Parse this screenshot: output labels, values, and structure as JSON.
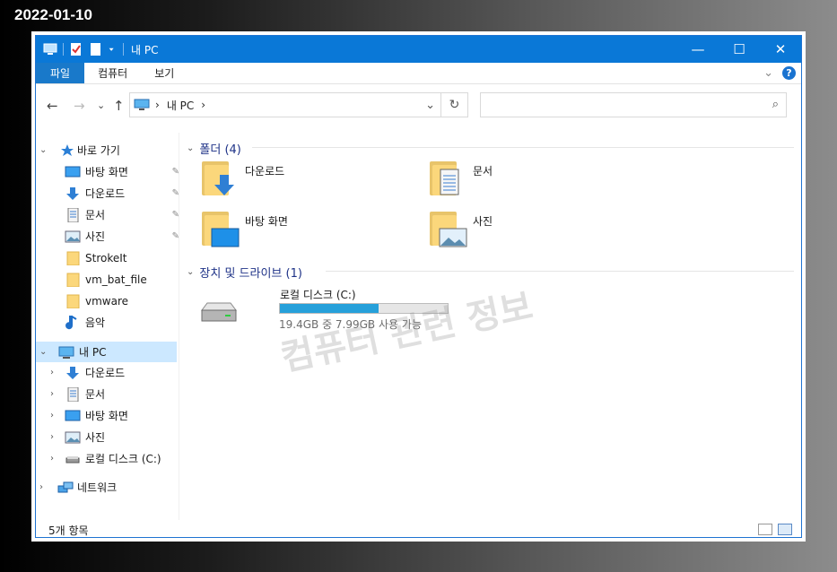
{
  "date_stamp": "2022-01-10",
  "window": {
    "title": "내 PC",
    "controls": {
      "minimize": "—",
      "maximize": "☐",
      "close": "✕"
    }
  },
  "ribbon": {
    "tabs": [
      "파일",
      "컴퓨터",
      "보기"
    ],
    "expand_glyph": "⌄",
    "help_glyph": "?"
  },
  "address": {
    "back": "←",
    "forward": "→",
    "recent": "⌄",
    "up": "↑",
    "crumbs": [
      "›",
      "내 PC",
      "›"
    ],
    "dropdown": "⌄",
    "refresh": "↻",
    "search_placeholder": "",
    "search_glyph": "⌕"
  },
  "nav": {
    "quick_access": "바로 가기",
    "quick_items": [
      {
        "label": "바탕 화면",
        "icon": "desktop-icon",
        "pinned": true
      },
      {
        "label": "다운로드",
        "icon": "download-icon",
        "pinned": true
      },
      {
        "label": "문서",
        "icon": "document-icon",
        "pinned": true
      },
      {
        "label": "사진",
        "icon": "pictures-icon",
        "pinned": true
      },
      {
        "label": "StrokeIt",
        "icon": "folder-icon",
        "pinned": false
      },
      {
        "label": "vm_bat_file",
        "icon": "folder-icon",
        "pinned": false
      },
      {
        "label": "vmware",
        "icon": "folder-icon",
        "pinned": false
      },
      {
        "label": "음악",
        "icon": "music-icon",
        "pinned": false
      }
    ],
    "this_pc": "내 PC",
    "pc_items": [
      {
        "label": "다운로드",
        "icon": "download-icon"
      },
      {
        "label": "문서",
        "icon": "document-icon"
      },
      {
        "label": "바탕 화면",
        "icon": "desktop-icon"
      },
      {
        "label": "사진",
        "icon": "pictures-icon"
      },
      {
        "label": "로컬 디스크 (C:)",
        "icon": "drive-icon"
      }
    ],
    "network": "네트워크",
    "pin_glyph": "📌"
  },
  "content": {
    "folders_group": "폴더 (4)",
    "folders": [
      {
        "label": "다운로드",
        "overlay": "download-icon"
      },
      {
        "label": "문서",
        "overlay": "document-icon"
      },
      {
        "label": "바탕 화면",
        "overlay": "desktop-icon"
      },
      {
        "label": "사진",
        "overlay": "pictures-icon"
      }
    ],
    "drives_group": "장치 및 드라이브 (1)",
    "drive": {
      "label": "로컬 디스크 (C:)",
      "detail": "19.4GB 중 7.99GB 사용 가능",
      "used_fraction": 0.59
    }
  },
  "watermark": "컴퓨터 관련 정보",
  "status": {
    "count": "5개 항목"
  },
  "colors": {
    "titlebar": "#0a78d7",
    "file_tab": "#1979ca",
    "selection": "#cce8ff",
    "group_text": "#1e3287",
    "capacity": "#26a0da"
  }
}
